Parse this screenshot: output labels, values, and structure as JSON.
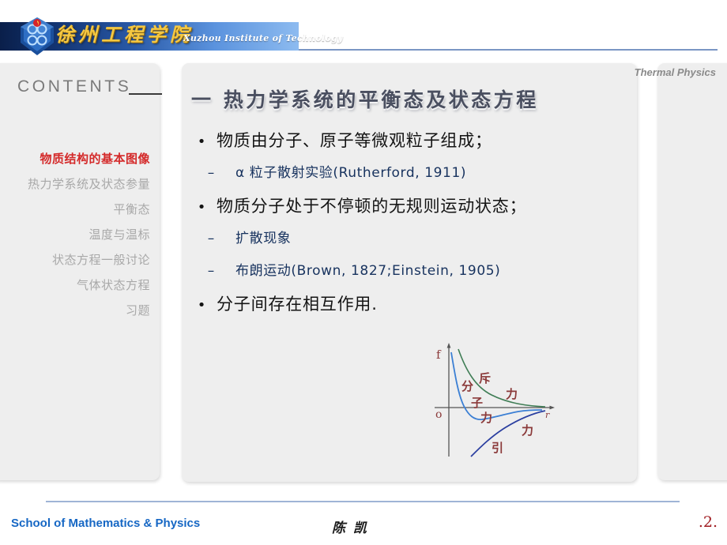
{
  "header": {
    "logo_cn": "徐州工程学院",
    "logo_en": "Xuzhou Institute of Technology",
    "logo_icon": "university-emblem-icon",
    "banner_gradient_start": "#0a1f4a",
    "banner_gradient_end": "#8dbbf0"
  },
  "sidebar": {
    "heading": "CONTENTS",
    "active_color": "#d42a2a",
    "inactive_color": "#a8a8a8",
    "items": [
      {
        "label": "物质结构的基本图像",
        "active": true
      },
      {
        "label": "热力学系统及状态参量",
        "active": false
      },
      {
        "label": "平衡态",
        "active": false
      },
      {
        "label": "温度与温标",
        "active": false
      },
      {
        "label": "状态方程一般讨论",
        "active": false
      },
      {
        "label": "气体状态方程",
        "active": false
      },
      {
        "label": "习题",
        "active": false
      }
    ]
  },
  "content": {
    "course_tag": "Thermal Physics",
    "title": "一 热力学系统的平衡态及状态方程",
    "title_color": "#4a4f60",
    "bullets": [
      {
        "level": 1,
        "mark": "•",
        "text": "物质由分子、原子等微观粒子组成；"
      },
      {
        "level": 2,
        "mark": "–",
        "text": "α 粒子散射实验(Rutherford, 1911)"
      },
      {
        "level": 1,
        "mark": "•",
        "text": "物质分子处于不停顿的无规则运动状态；"
      },
      {
        "level": 2,
        "mark": "–",
        "text": "扩散现象"
      },
      {
        "level": 2,
        "mark": "–",
        "text": "布朗运动(Brown, 1827;Einstein, 1905)"
      },
      {
        "level": 1,
        "mark": "•",
        "text": "分子间存在相互作用."
      }
    ]
  },
  "force_diagram": {
    "y_axis_label": "f",
    "origin_label": "o",
    "x_axis_label": "r",
    "label_color": "#8b3a3a",
    "curves": [
      {
        "name": "repulsive-force-curve",
        "label": "斥 力",
        "color": "#3f7d55"
      },
      {
        "name": "molecular-force-curve",
        "label": "分 子 力",
        "color": "#3b7fd4"
      },
      {
        "name": "attractive-force-curve",
        "label": "引 力",
        "color": "#2b3fa0"
      }
    ],
    "label_repulsive_a": "斥",
    "label_repulsive_b": "力",
    "label_molecular_a": "分",
    "label_molecular_b": "子",
    "label_molecular_c": "力",
    "label_attractive_a": "引",
    "label_attractive_b": "力"
  },
  "footer": {
    "school": "School of Mathematics & Physics",
    "author": "陈 凯",
    "page": ".2.",
    "school_color": "#1667c4",
    "page_color": "#a01b20",
    "rule_color": "#9fb4d6"
  }
}
